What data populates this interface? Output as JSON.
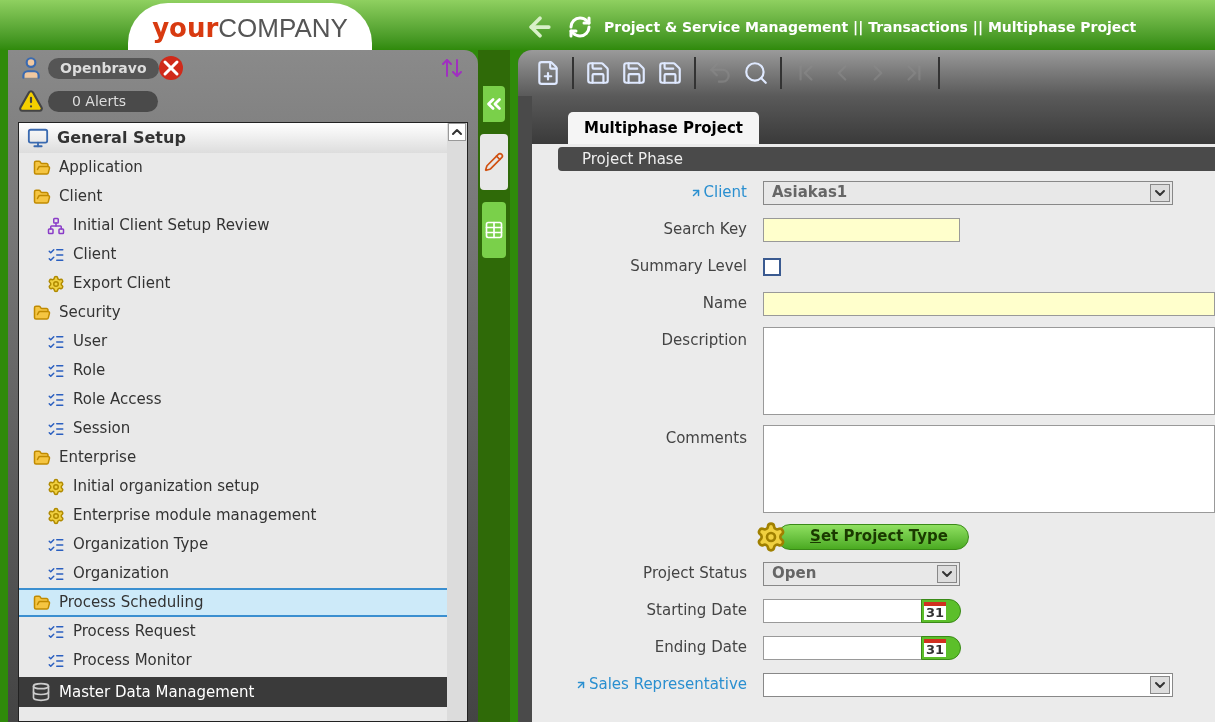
{
  "header": {
    "logo": {
      "prefix": "your",
      "suffix": "COMPANY"
    },
    "breadcrumb": "Project & Service Management || Transactions || Multiphase Project"
  },
  "user": {
    "name": "Openbravo",
    "alerts": "0 Alerts"
  },
  "menu": {
    "title": "General Setup",
    "items": [
      {
        "label": "Application",
        "kind": "folder",
        "selected": false
      },
      {
        "label": "Client",
        "kind": "folder",
        "selected": false,
        "children": [
          {
            "label": "Initial Client Setup Review",
            "kind": "tree",
            "selected": false
          },
          {
            "label": "Client",
            "kind": "window",
            "selected": false
          },
          {
            "label": "Export Client",
            "kind": "process",
            "selected": false
          }
        ]
      },
      {
        "label": "Security",
        "kind": "folder",
        "selected": false,
        "children": [
          {
            "label": "User",
            "kind": "window",
            "selected": false
          },
          {
            "label": "Role",
            "kind": "window",
            "selected": false
          },
          {
            "label": "Role Access",
            "kind": "window",
            "selected": false
          },
          {
            "label": "Session",
            "kind": "window",
            "selected": false
          }
        ]
      },
      {
        "label": "Enterprise",
        "kind": "folder",
        "selected": false,
        "children": [
          {
            "label": "Initial organization setup",
            "kind": "process",
            "selected": false
          },
          {
            "label": "Enterprise module management",
            "kind": "process",
            "selected": false
          },
          {
            "label": "Organization Type",
            "kind": "window",
            "selected": false
          },
          {
            "label": "Organization",
            "kind": "window",
            "selected": false
          }
        ]
      },
      {
        "label": "Process Scheduling",
        "kind": "folder",
        "selected": true,
        "children": [
          {
            "label": "Process Request",
            "kind": "window",
            "selected": false
          },
          {
            "label": "Process Monitor",
            "kind": "window",
            "selected": false
          }
        ]
      }
    ],
    "footer": "Master Data Management"
  },
  "toolbar": [
    {
      "kind": "new",
      "disabled": false
    },
    {
      "kind": "sep"
    },
    {
      "kind": "save-next",
      "disabled": false
    },
    {
      "kind": "save-new",
      "disabled": false
    },
    {
      "kind": "save",
      "disabled": false
    },
    {
      "kind": "sep"
    },
    {
      "kind": "undo",
      "disabled": true
    },
    {
      "kind": "search",
      "disabled": false
    },
    {
      "kind": "sep"
    },
    {
      "kind": "first",
      "disabled": true
    },
    {
      "kind": "previous",
      "disabled": true
    },
    {
      "kind": "next",
      "disabled": true
    },
    {
      "kind": "last",
      "disabled": true
    },
    {
      "kind": "sep"
    }
  ],
  "tabs": [
    {
      "label": "Multiphase Project",
      "selected": true
    }
  ],
  "section": "Project Phase",
  "fields": [
    {
      "kind": "select",
      "label": "Client",
      "link": true,
      "value": "Asiakas1",
      "required": false
    },
    {
      "kind": "text",
      "label": "Search Key",
      "link": false,
      "required": true
    },
    {
      "kind": "checkbox",
      "label": "Summary Level",
      "link": false,
      "checked": false
    },
    {
      "kind": "text",
      "label": "Name",
      "link": false,
      "required": true,
      "wide": true
    },
    {
      "kind": "textarea",
      "label": "Description",
      "link": false
    },
    {
      "kind": "textarea",
      "label": "Comments",
      "link": false
    },
    {
      "kind": "button",
      "label": "Set Project Type"
    },
    {
      "kind": "select",
      "label": "Project Status",
      "link": false,
      "value": "Open",
      "required": false,
      "short": true
    },
    {
      "kind": "date",
      "label": "Starting Date",
      "link": false,
      "day": "31"
    },
    {
      "kind": "date",
      "label": "Ending Date",
      "link": false,
      "day": "31"
    },
    {
      "kind": "select",
      "label": "Sales Representative",
      "link": true,
      "required": false
    }
  ]
}
